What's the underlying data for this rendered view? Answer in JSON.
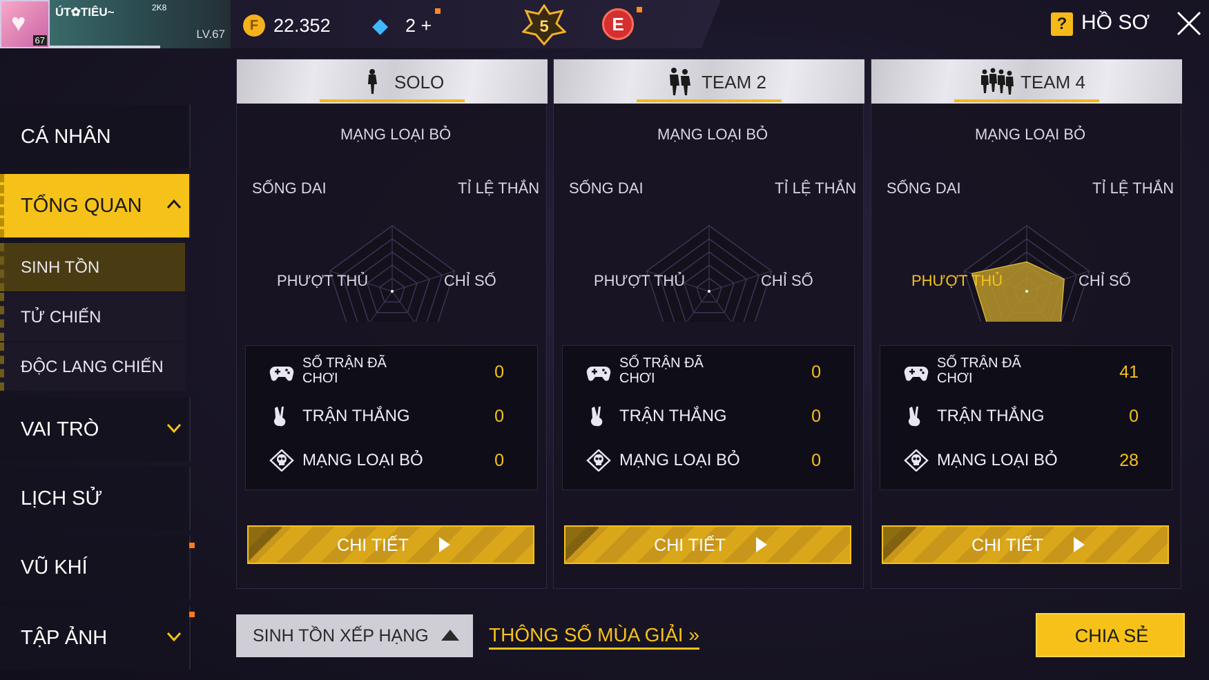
{
  "player": {
    "name": "ÚT✿TIÊU~",
    "tag": "2K8",
    "avatar_level": "67",
    "level": "LV.67"
  },
  "currency": {
    "coins": "22.352",
    "diamonds": "2 +",
    "rank_badge": "5",
    "elite_badge": "E"
  },
  "header": {
    "help_icon": "?",
    "title": "HỒ SƠ"
  },
  "sidebar": {
    "items": [
      {
        "label": "CÁ NHÂN"
      },
      {
        "label": "TỔNG QUAN"
      },
      {
        "label": "VAI TRÒ"
      },
      {
        "label": "LỊCH SỬ"
      },
      {
        "label": "VŨ KHÍ"
      },
      {
        "label": "TẬP ẢNH"
      }
    ],
    "subitems": [
      {
        "label": "SINH TỒN"
      },
      {
        "label": "TỬ CHIẾN"
      },
      {
        "label": "ĐỘC LANG CHIẾN"
      }
    ]
  },
  "radar_labels": {
    "top": "MẠNG LOẠI BỎ",
    "left": "SỐNG DAI",
    "right": "TỈ LỆ THẮNG",
    "bottom_left": "PHƯỢT THỦ",
    "bottom_right": "CHỈ SỐ"
  },
  "stat_labels": {
    "matches": "SỐ TRẬN ĐÃ CHƠI",
    "wins": "TRẬN THẮNG",
    "kills": "MẠNG LOẠI BỎ"
  },
  "panels": [
    {
      "mode": "SOLO",
      "matches": "0",
      "wins": "0",
      "kills": "0",
      "radar": [
        0,
        0,
        0,
        0,
        0
      ]
    },
    {
      "mode": "TEAM 2",
      "matches": "0",
      "wins": "0",
      "kills": "0",
      "radar": [
        0,
        0,
        0,
        0,
        0
      ]
    },
    {
      "mode": "TEAM 4",
      "matches": "41",
      "wins": "0",
      "kills": "28",
      "radar": [
        0.45,
        0.6,
        0.85,
        0.9,
        0.88
      ]
    }
  ],
  "detail_button": "CHI TIẾT",
  "footer": {
    "mode_select": "SINH TỒN XẾP HẠNG",
    "season_link": "THÔNG SỐ MÙA GIẢI »",
    "share_button": "CHIA SẺ"
  },
  "colors": {
    "accent": "#f6c21a",
    "background": "#1a1628",
    "radar_fill": "#b8972a"
  },
  "icons": [
    "coin-icon",
    "diamond-icon",
    "rank-badge-icon",
    "elite-pass-icon",
    "help-icon",
    "close-icon",
    "gamepad-icon",
    "victory-hand-icon",
    "skull-icon",
    "chevron-up-icon",
    "chevron-down-icon",
    "play-icon",
    "triangle-up-icon"
  ]
}
